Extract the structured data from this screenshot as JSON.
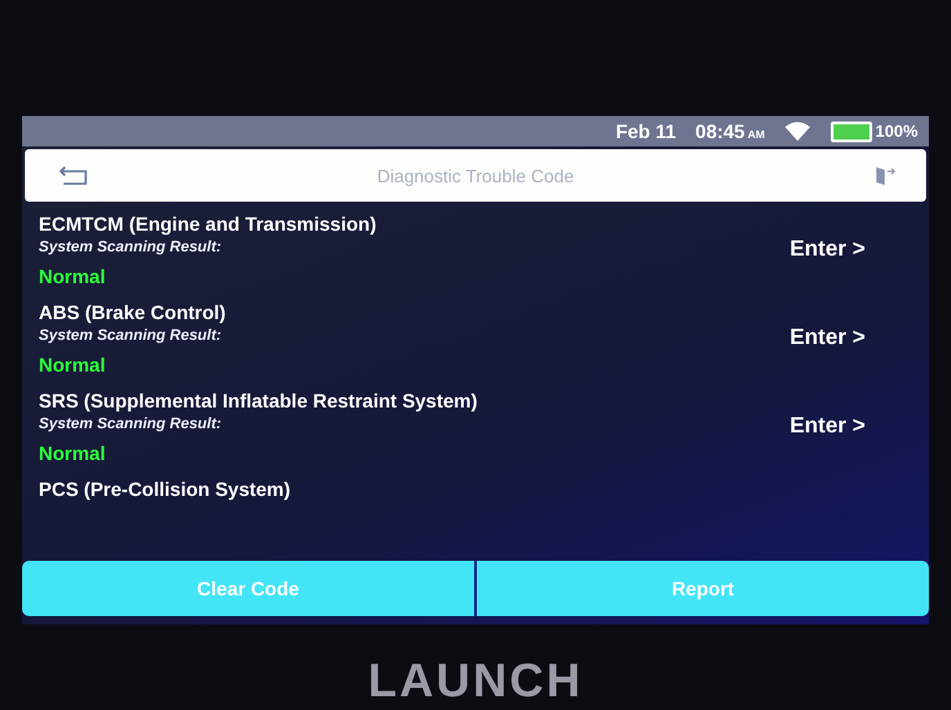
{
  "device_logo": "LAUNCH",
  "status_bar": {
    "date": "Feb 11",
    "time": "08:45",
    "ampm": "AM",
    "battery": {
      "level": 1,
      "reading": "100%"
    }
  },
  "title_bar": {
    "title": "Diagnostic Trouble Code"
  },
  "systems": [
    {
      "name": "ECMTCM (Engine and Transmission)",
      "result_label": "System Scanning Result:",
      "result": "Normal",
      "action": "Enter >"
    },
    {
      "name": "ABS (Brake Control)",
      "result_label": "System Scanning Result:",
      "result": "Normal",
      "action": "Enter >"
    },
    {
      "name": "SRS (Supplemental Inflatable Restraint System)",
      "result_label": "System Scanning Result:",
      "result": "Normal",
      "action": "Enter >"
    },
    {
      "name": "PCS (Pre-Collision System)"
    }
  ],
  "buttons": [
    "Clear Code",
    "Report"
  ]
}
